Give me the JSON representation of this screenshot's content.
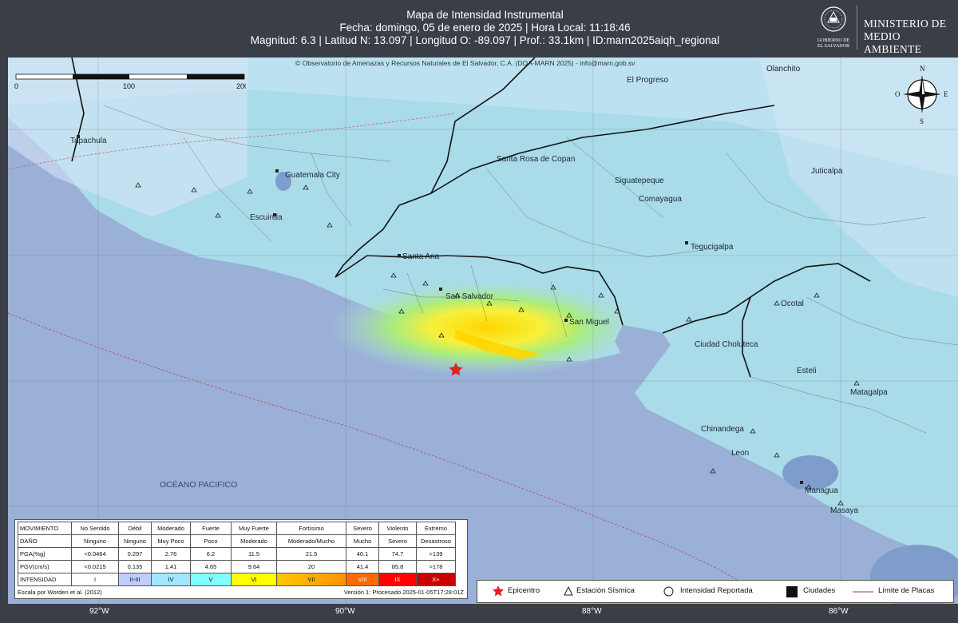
{
  "header": {
    "title": "Mapa de Intensidad Instrumental",
    "date_line": "Fecha: domingo, 05 de enero de 2025 | Hora Local: 11:18:46",
    "params_line": "Magnitud: 6.3 | Latitud N: 13.097 | Longitud O: -89.097 | Prof.: 33.1km | ID:marn2025aiqh_regional",
    "ministry_line1": "MINISTERIO DE",
    "ministry_line2": "MEDIO AMBIENTE",
    "logo_caption1": "GOBIERNO DE",
    "logo_caption2": "EL SALVADOR"
  },
  "map": {
    "copyright": "© Observatorio de Amenazas y Recursos Naturales de El Salvador, C.A. (DOA-MARN 2025) - info@marn.gob.sv",
    "scale_labels": [
      "0",
      "100",
      "200"
    ],
    "compass": {
      "n": "N",
      "s": "S",
      "e": "E",
      "o": "O"
    },
    "ocean_label": "OCÉANO PACIFICO",
    "cities": {
      "tapachula": "Tapachula",
      "guatemala": "Guatemala City",
      "escuintla": "Escuintla",
      "santa_ana": "Santa Ana",
      "san_salvador": "San Salvador",
      "san_miguel": "San Miguel",
      "santa_rosa": "Santa Rosa de Copan",
      "siguatepeque": "Siguatepeque",
      "comayagua": "Comayagua",
      "tegucigalpa": "Tegucigalpa",
      "el_progreso": "El Progreso",
      "olanchito": "Olanchito",
      "juticalpa": "Juticalpa",
      "ocotal": "Ocotal",
      "choluteca": "Ciudad Choluteca",
      "esteli": "Esteli",
      "matagalpa": "Matagalpa",
      "chinandega": "Chinandega",
      "leon": "Leon",
      "managua": "Managua",
      "masaya": "Masaya"
    },
    "longitudes": [
      "92°W",
      "90°W",
      "88°W",
      "86°W"
    ],
    "colors": {
      "sea": "#9ab0d6",
      "land": "#a9dbe9",
      "epicenter": "#e0221e"
    }
  },
  "legend": {
    "rows": [
      {
        "head": "MOVIMIENTO",
        "cells": [
          "No Sentido",
          "Débil",
          "Moderado",
          "Fuerte",
          "Muy Fuerte",
          "Fortísimo",
          "Severo",
          "Violento",
          "Extremo"
        ]
      },
      {
        "head": "DAÑO",
        "cells": [
          "Ninguno",
          "Ninguno",
          "Muy Poco",
          "Poco",
          "Moderado",
          "Moderado/Mucho",
          "Mucho",
          "Severo",
          "Desastroso"
        ]
      },
      {
        "head": "PGA(%g)",
        "cells": [
          "<0.0464",
          "0.297",
          "2.76",
          "6.2",
          "11.5",
          "21.5",
          "40.1",
          "74.7",
          ">139"
        ]
      },
      {
        "head": "PGV(cm/s)",
        "cells": [
          "<0.0215",
          "0.135",
          "1.41",
          "4.65",
          "9.64",
          "20",
          "41.4",
          "85.8",
          ">178"
        ]
      }
    ],
    "intensity_head": "INTENSIDAD",
    "intensity": [
      "I",
      "II-III",
      "IV",
      "V",
      "VI",
      "VII",
      "VIII",
      "IX",
      "X+"
    ],
    "intensity_colors": [
      "#ffffff",
      "#bfccff",
      "#a0e6ff",
      "#80ffff",
      "#7aff93",
      "#ffff00",
      "#ffc800",
      "#ff9100",
      "#ff0000",
      "#c80000"
    ],
    "source": "Escala por Worden et al. (2012)",
    "version": "Versión 1: Procesado 2025-01-05T17:28:01Z"
  },
  "key": {
    "epicenter": "Epicentro",
    "station": "Estación Sísmica",
    "reported": "Intensidad Reportada",
    "cities": "Ciudades",
    "plates": "Límite de Placas"
  }
}
